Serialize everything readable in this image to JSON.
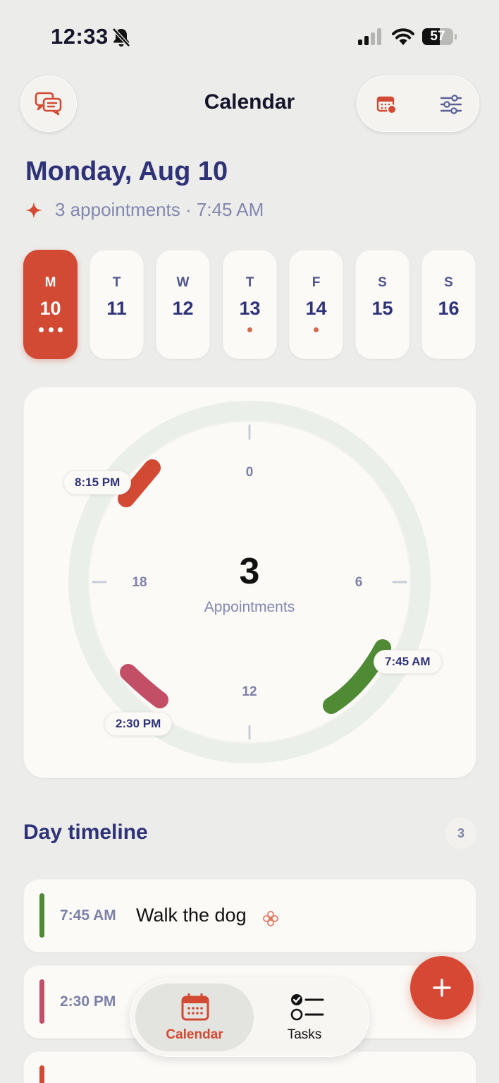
{
  "status_bar": {
    "time": "12:33",
    "battery": "57",
    "battery_level": 0.57
  },
  "header": {
    "title": "Calendar"
  },
  "date": {
    "heading": "Monday, Aug 10",
    "summary": "3 appointments · 7:45 AM"
  },
  "week": [
    {
      "letter": "M",
      "num": "10",
      "active": true,
      "dots": 3
    },
    {
      "letter": "T",
      "num": "11",
      "dots": 0
    },
    {
      "letter": "W",
      "num": "12",
      "dots": 0
    },
    {
      "letter": "T",
      "num": "13",
      "dots": 1
    },
    {
      "letter": "F",
      "num": "14",
      "dots": 1
    },
    {
      "letter": "S",
      "num": "15",
      "dots": 0
    },
    {
      "letter": "S",
      "num": "16",
      "dots": 0
    }
  ],
  "clock": {
    "count": "3",
    "count_label": "Appointments",
    "hours": {
      "h0": "0",
      "h6": "6",
      "h12": "12",
      "h18": "18"
    },
    "tags": {
      "evening": "8:15 PM",
      "afternoon": "2:30 PM",
      "morning": "7:45 AM"
    }
  },
  "timeline": {
    "title": "Day timeline",
    "count": "3",
    "events": [
      {
        "time": "7:45 AM",
        "title": "Walk the dog",
        "color": "#4f8a34"
      },
      {
        "time": "2:30 PM",
        "title": "",
        "color": "#c34f67"
      },
      {
        "time": "",
        "title": "",
        "color": "#d24a33"
      }
    ]
  },
  "tabbar": {
    "calendar_label": "Calendar",
    "tasks_label": "Tasks"
  },
  "colors": {
    "accent": "#d24a33",
    "navy": "#2e3277",
    "green": "#4f8a34",
    "pink": "#c34f67"
  }
}
